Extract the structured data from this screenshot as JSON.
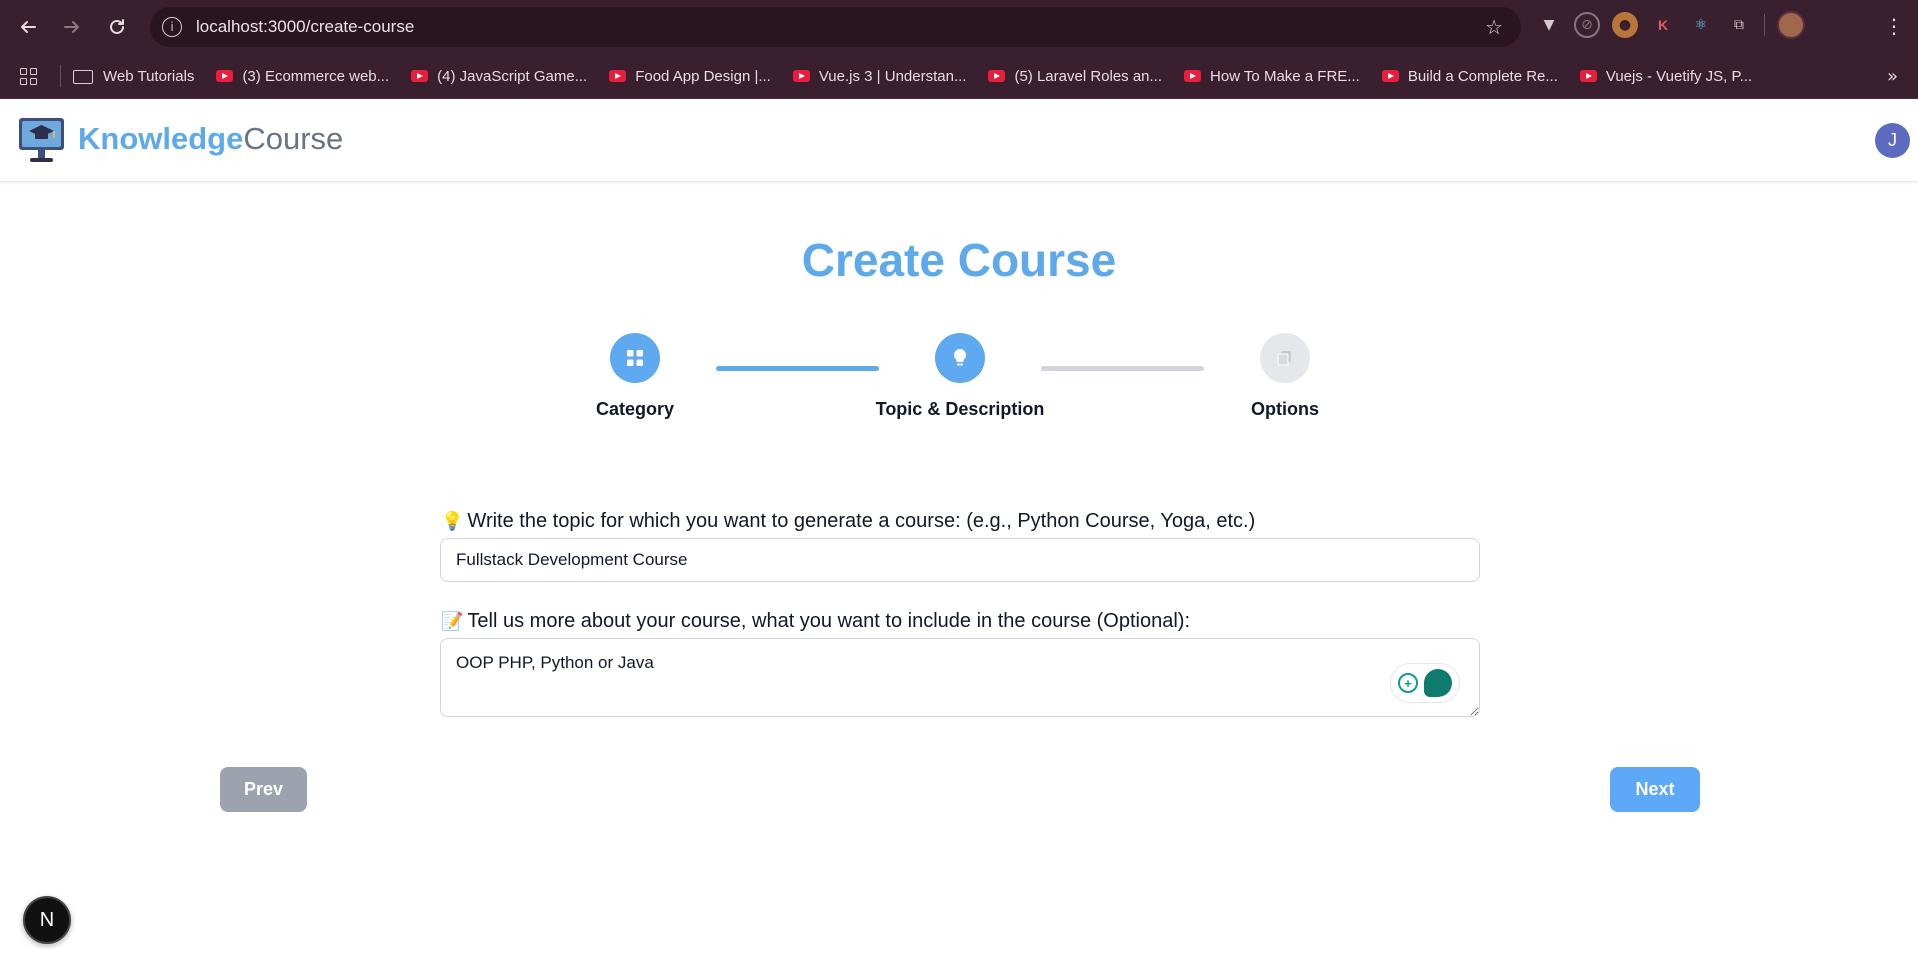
{
  "browser": {
    "url": "localhost:3000/create-course",
    "bookmarks": [
      {
        "label": "Web Tutorials",
        "type": "folder"
      },
      {
        "label": "(3) Ecommerce web...",
        "type": "youtube"
      },
      {
        "label": "(4) JavaScript Game...",
        "type": "youtube"
      },
      {
        "label": "Food App Design |...",
        "type": "youtube"
      },
      {
        "label": "Vue.js 3 | Understan...",
        "type": "youtube"
      },
      {
        "label": "(5) Laravel Roles an...",
        "type": "youtube"
      },
      {
        "label": "How To Make a FRE...",
        "type": "youtube"
      },
      {
        "label": "Build a Complete Re...",
        "type": "youtube"
      },
      {
        "label": "Vuejs - Vuetify JS, P...",
        "type": "youtube"
      }
    ]
  },
  "header": {
    "brand_bold": "Knowledge",
    "brand_light": "Course",
    "avatar_initial": "J"
  },
  "main": {
    "title": "Create Course",
    "steps": [
      {
        "label": "Category",
        "icon": "grid-icon",
        "state": "active"
      },
      {
        "label": "Topic & Description",
        "icon": "lightbulb-icon",
        "state": "active"
      },
      {
        "label": "Options",
        "icon": "clipboard-icon",
        "state": "inactive"
      }
    ],
    "topic_label_emoji": "💡",
    "topic_label": "Write the topic for which you want to generate a course: (e.g., Python Course, Yoga, etc.)",
    "topic_value": "Fullstack Development Course",
    "description_label_emoji": "📝",
    "description_label": "Tell us more about your course, what you want to include in the course (Optional):",
    "description_value": "OOP PHP, Python or Java",
    "prev_label": "Prev",
    "next_label": "Next"
  },
  "devtools_badge": "N",
  "colors": {
    "accent": "#5ea9ea",
    "chrome_bg": "#3a1f2e",
    "prev_button": "#9ca3af",
    "next_button": "#5ea9f7"
  }
}
